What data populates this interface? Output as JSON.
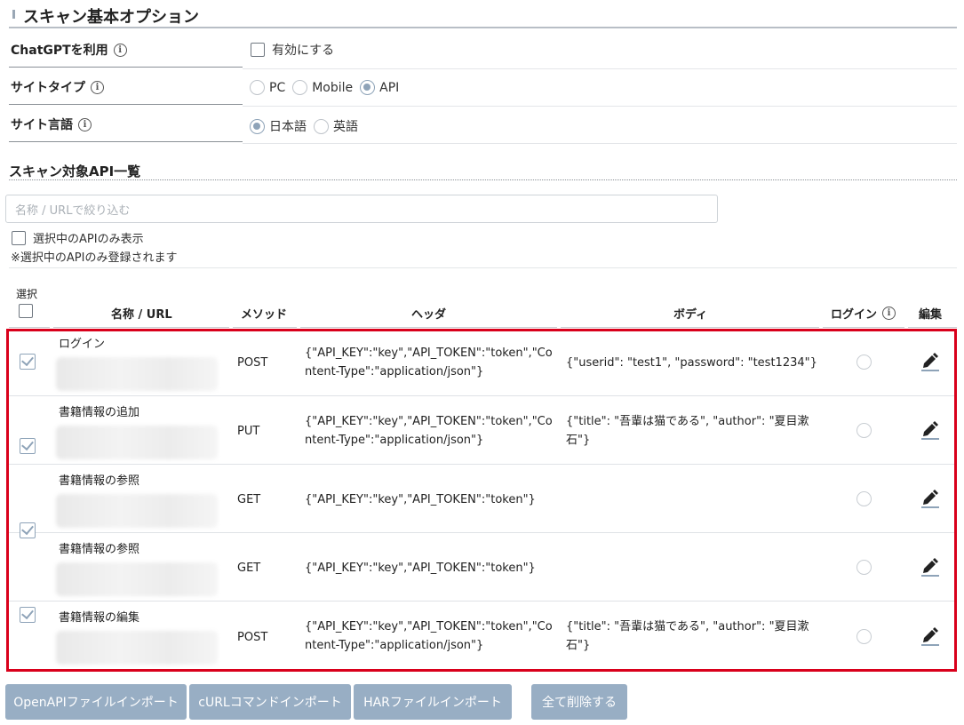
{
  "scan_options": {
    "title": "スキャン基本オプション",
    "chatgpt": {
      "label": "ChatGPTを利用",
      "checkbox_label": "有効にする"
    },
    "site_type": {
      "label": "サイトタイプ",
      "options": [
        "PC",
        "Mobile",
        "API"
      ],
      "selected": "API"
    },
    "site_language": {
      "label": "サイト言語",
      "options": [
        "日本語",
        "英語"
      ],
      "selected": "日本語"
    }
  },
  "api_list": {
    "title": "スキャン対象API一覧",
    "filter_placeholder": "名称 / URLで絞り込む",
    "show_selected_label": "選択中のAPIのみ表示",
    "note": "※選択中のAPIのみ登録されます",
    "columns": {
      "select": "選択",
      "name": "名称 / URL",
      "method": "メソッド",
      "header": "ヘッダ",
      "body": "ボディ",
      "login": "ログイン",
      "edit": "編集"
    },
    "rows": [
      {
        "name": "ログイン",
        "method": "POST",
        "header": "{\"API_KEY\":\"key\",\"API_TOKEN\":\"token\",\"Content-Type\":\"application/json\"}",
        "body": "{\"userid\": \"test1\", \"password\": \"test1234\"}",
        "selected": true
      },
      {
        "name": "書籍情報の追加",
        "method": "PUT",
        "header": "{\"API_KEY\":\"key\",\"API_TOKEN\":\"token\",\"Content-Type\":\"application/json\"}",
        "body": "{\"title\": \"吾輩は猫である\", \"author\": \"夏目漱石\"}",
        "selected": true
      },
      {
        "name": "書籍情報の参照",
        "method": "GET",
        "header": "{\"API_KEY\":\"key\",\"API_TOKEN\":\"token\"}",
        "body": "",
        "selected": true
      },
      {
        "name": "書籍情報の参照",
        "method": "GET",
        "header": "{\"API_KEY\":\"key\",\"API_TOKEN\":\"token\"}",
        "body": "",
        "selected": true
      },
      {
        "name": "書籍情報の編集",
        "method": "POST",
        "header": "{\"API_KEY\":\"key\",\"API_TOKEN\":\"token\",\"Content-Type\":\"application/json\"}",
        "body": "{\"title\": \"吾輩は猫である\", \"author\": \"夏目漱石\"}",
        "selected": true
      }
    ]
  },
  "buttons": {
    "openapi_import": "OpenAPIファイルインポート",
    "curl_import": "cURLコマンドインポート",
    "har_import": "HARファイルインポート",
    "delete_all": "全て削除する"
  },
  "colors": {
    "accent": "#98aec4",
    "highlight_border": "#d9001b"
  }
}
